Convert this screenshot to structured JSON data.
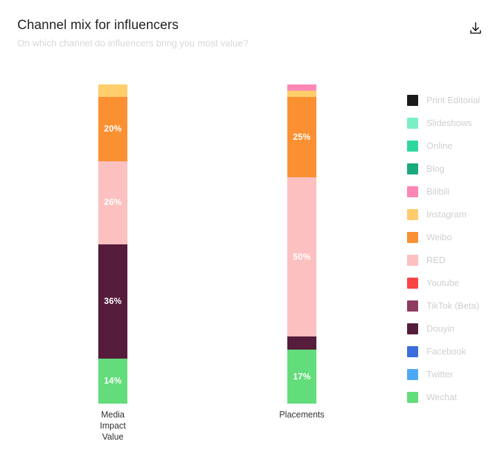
{
  "header": {
    "title": "Channel mix for influencers",
    "subtitle": "On which channel do influencers bring you most value?",
    "download_icon": "download-icon"
  },
  "chart_data": {
    "type": "bar",
    "subtype": "stacked-percentage-column",
    "title": "Channel mix for influencers",
    "subtitle": "On which channel do influencers bring you most value?",
    "xlabel": "",
    "ylabel": "",
    "ylim": [
      0,
      100
    ],
    "grid": false,
    "legend_position": "right",
    "categories": [
      "Media Impact Value",
      "Placements"
    ],
    "category_label_lines": [
      [
        "Media",
        "Impact",
        "Value"
      ],
      [
        "Placements"
      ]
    ],
    "series": [
      {
        "name": "Print Editorial",
        "color": "#1a1a1a",
        "values": [
          0,
          0
        ],
        "labels": [
          "",
          ""
        ]
      },
      {
        "name": "Slideshows",
        "color": "#7aeec4",
        "values": [
          0,
          0
        ],
        "labels": [
          "",
          ""
        ]
      },
      {
        "name": "Online",
        "color": "#2fd7a0",
        "values": [
          0,
          0
        ],
        "labels": [
          "",
          ""
        ]
      },
      {
        "name": "Blog",
        "color": "#1aa97c",
        "values": [
          0,
          0
        ],
        "labels": [
          "",
          ""
        ]
      },
      {
        "name": "Bilibili",
        "color": "#fc87b4",
        "values": [
          0,
          2
        ],
        "labels": [
          "",
          ""
        ]
      },
      {
        "name": "Instagram",
        "color": "#ffcd6b",
        "values": [
          4,
          2
        ],
        "labels": [
          "",
          ""
        ]
      },
      {
        "name": "Weibo",
        "color": "#fb9032",
        "values": [
          20,
          25
        ],
        "labels": [
          "20%",
          "25%"
        ]
      },
      {
        "name": "RED",
        "color": "#fdc0c0",
        "values": [
          26,
          50
        ],
        "labels": [
          "26%",
          "50%"
        ]
      },
      {
        "name": "Youtube",
        "color": "#fc4444",
        "values": [
          0,
          0
        ],
        "labels": [
          "",
          ""
        ]
      },
      {
        "name": "TikTok (Beta)",
        "color": "#8d3b5e",
        "values": [
          0,
          0
        ],
        "labels": [
          "",
          ""
        ]
      },
      {
        "name": "Douyin",
        "color": "#551c3b",
        "values": [
          36,
          4
        ],
        "labels": [
          "36%",
          ""
        ]
      },
      {
        "name": "Facebook",
        "color": "#3a6ddc",
        "values": [
          0,
          0
        ],
        "labels": [
          "",
          ""
        ]
      },
      {
        "name": "Twitter",
        "color": "#4fa8f7",
        "values": [
          0,
          0
        ],
        "labels": [
          "",
          ""
        ]
      },
      {
        "name": "Wechat",
        "color": "#63dc7b",
        "values": [
          14,
          17
        ],
        "labels": [
          "14%",
          "17%"
        ]
      }
    ],
    "stack_order_top_to_bottom": [
      "Bilibili",
      "Instagram",
      "Weibo",
      "RED",
      "Douyin",
      "Wechat"
    ]
  },
  "legend": {
    "items": [
      {
        "label": "Print Editorial",
        "color": "#1a1a1a"
      },
      {
        "label": "Slideshows",
        "color": "#7aeec4"
      },
      {
        "label": "Online",
        "color": "#2fd7a0"
      },
      {
        "label": "Blog",
        "color": "#1aa97c"
      },
      {
        "label": "Bilibili",
        "color": "#fc87b4"
      },
      {
        "label": "Instagram",
        "color": "#ffcd6b"
      },
      {
        "label": "Weibo",
        "color": "#fb9032"
      },
      {
        "label": "RED",
        "color": "#fdc0c0"
      },
      {
        "label": "Youtube",
        "color": "#fc4444"
      },
      {
        "label": "TikTok (Beta)",
        "color": "#8d3b5e"
      },
      {
        "label": "Douyin",
        "color": "#551c3b"
      },
      {
        "label": "Facebook",
        "color": "#3a6ddc"
      },
      {
        "label": "Twitter",
        "color": "#4fa8f7"
      },
      {
        "label": "Wechat",
        "color": "#63dc7b"
      }
    ]
  }
}
